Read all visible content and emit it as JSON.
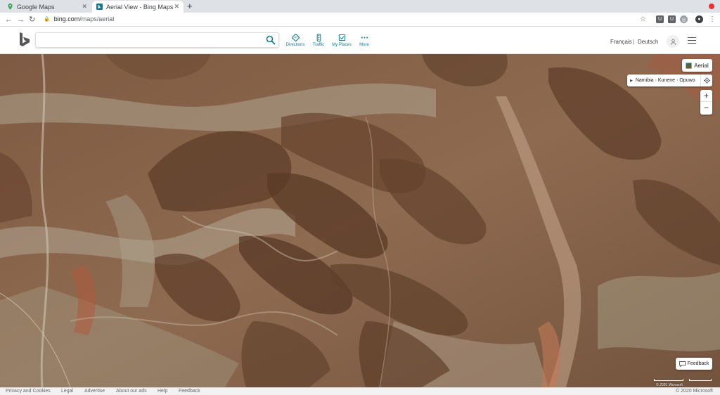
{
  "browser": {
    "tabs": [
      {
        "title": "Google Maps",
        "active": false
      },
      {
        "title": "Aerial View - Bing Maps",
        "active": true
      }
    ],
    "new_tab": "+",
    "url_host": "bing.com",
    "url_path": "/maps/aerial"
  },
  "header": {
    "search_value": "",
    "tools": [
      {
        "label": "Directions",
        "icon": "directions-icon"
      },
      {
        "label": "Traffic",
        "icon": "traffic-icon"
      },
      {
        "label": "My Places",
        "icon": "my-places-icon"
      },
      {
        "label": "More",
        "icon": "more-icon"
      }
    ],
    "languages": [
      "Français",
      "Deutsch"
    ],
    "lang_separator": "|"
  },
  "map": {
    "style_button": "Aerial",
    "breadcrumb": [
      "Namibia",
      "Kunene",
      "Opuwo"
    ],
    "breadcrumb_sep": "›",
    "zoom_in": "+",
    "zoom_out": "−",
    "feedback": "Feedback",
    "scale_labels": [
      "",
      ""
    ],
    "copyright": "© 2020 Microsoft"
  },
  "footer": {
    "links": [
      "Privacy and Cookies",
      "Legal",
      "Advertise",
      "About our ads",
      "Help",
      "Feedback"
    ],
    "copyright": "© 2020 Microsoft"
  },
  "colors": {
    "bing_teal": "#0f7b9c",
    "terrain_brown": "#8b6448",
    "ridge_dark": "#5a3a26",
    "wash_light": "#b8ad9c"
  }
}
